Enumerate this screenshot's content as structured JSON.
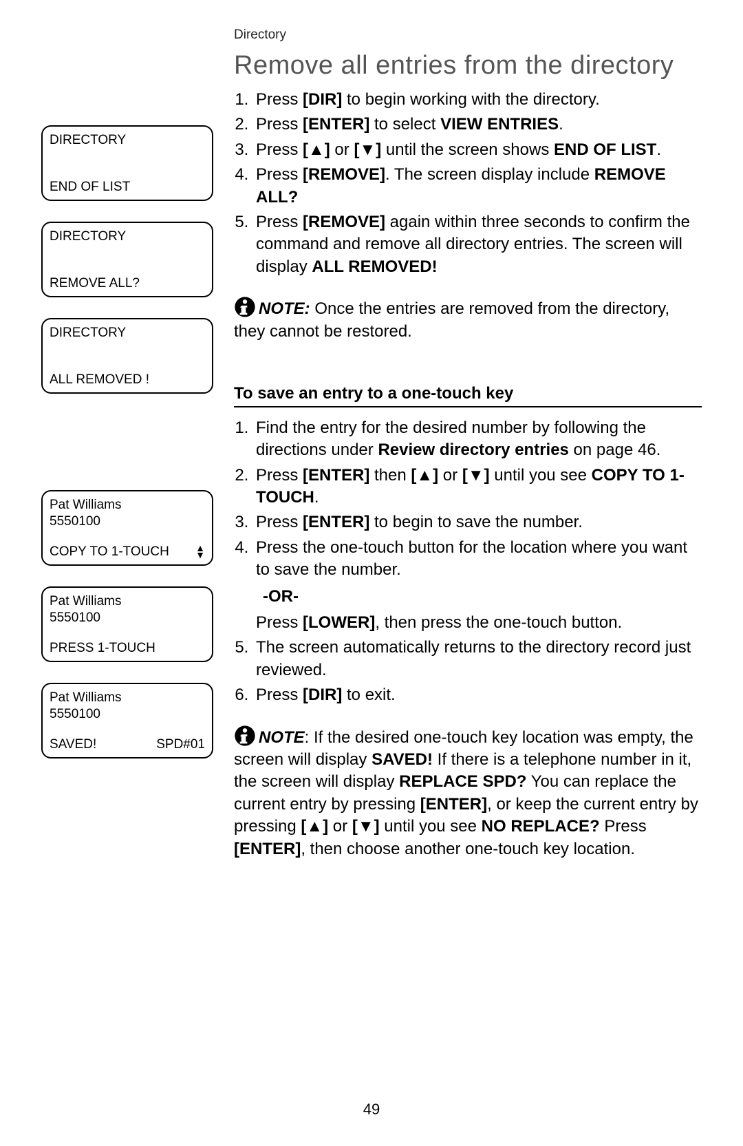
{
  "header": "Directory",
  "title": "Remove all entries from the directory",
  "screens_a": [
    {
      "top": "DIRECTORY",
      "bottom_left": "END OF LIST",
      "bottom_right": "",
      "arrows": false
    },
    {
      "top": "DIRECTORY",
      "bottom_left": "REMOVE ALL?",
      "bottom_right": "",
      "arrows": false
    },
    {
      "top": "DIRECTORY",
      "bottom_left": "ALL REMOVED !",
      "bottom_right": "",
      "arrows": false
    }
  ],
  "screens_b": [
    {
      "top": "Pat Williams\n5550100",
      "bottom_left": "COPY TO 1-TOUCH",
      "bottom_right": "",
      "arrows": true
    },
    {
      "top": "Pat Williams\n5550100",
      "bottom_left": "PRESS 1-TOUCH",
      "bottom_right": "",
      "arrows": false
    },
    {
      "top": "Pat Williams\n5550100",
      "bottom_left": "SAVED!",
      "bottom_right": "SPD#01",
      "arrows": false
    }
  ],
  "steps_a": [
    "Press <b>[DIR]</b> to begin working with the directory.",
    "Press <b>[ENTER]</b> to select <b>VIEW ENTRIES</b>.",
    "Press <b>[▲]</b> or <b>[▼]</b> until the screen shows <b>END OF LIST</b>.",
    "Press <b>[REMOVE]</b>. The screen display include <b>REMOVE ALL?</b>",
    "Press <b>[REMOVE]</b> again within three seconds to confirm the command and remove all directory entries. The screen will display <b>ALL REMOVED!</b>"
  ],
  "note_a": "<b><i>NOTE:</i></b> Once the entries are removed from the directory, they cannot be restored.",
  "subhead_b": "To save an entry to a one-touch key",
  "steps_b": [
    "Find the entry for the desired number by following the directions under <b>Review directory entries</b> on page 46.",
    "Press <b>[ENTER]</b> then <b>[▲]</b> or <b>[▼]</b> until you see <b>COPY TO 1-TOUCH</b>.",
    "Press <b>[ENTER]</b> to begin to save the number.",
    "Press the one-touch button for the location where you want to save the number.",
    "The screen automatically returns to the directory record just reviewed.",
    "Press <b>[DIR]</b> to exit."
  ],
  "or_label": "-OR-",
  "or_text": "Press <b>[LOWER]</b>, then press the one-touch button.",
  "note_b": "<b><i>NOTE</i></b>: If the desired one-touch key location was empty, the screen will display <b>SAVED!</b> If there is a telephone number in it, the screen will display <b>REPLACE SPD?</b> You can replace the current entry by pressing <b>[ENTER]</b>, or keep the current entry by pressing <b>[▲]</b> or <b>[▼]</b> until you see <b>NO REPLACE?</b> Press <b>[ENTER]</b>, then choose another one-touch key location.",
  "page_number": "49"
}
